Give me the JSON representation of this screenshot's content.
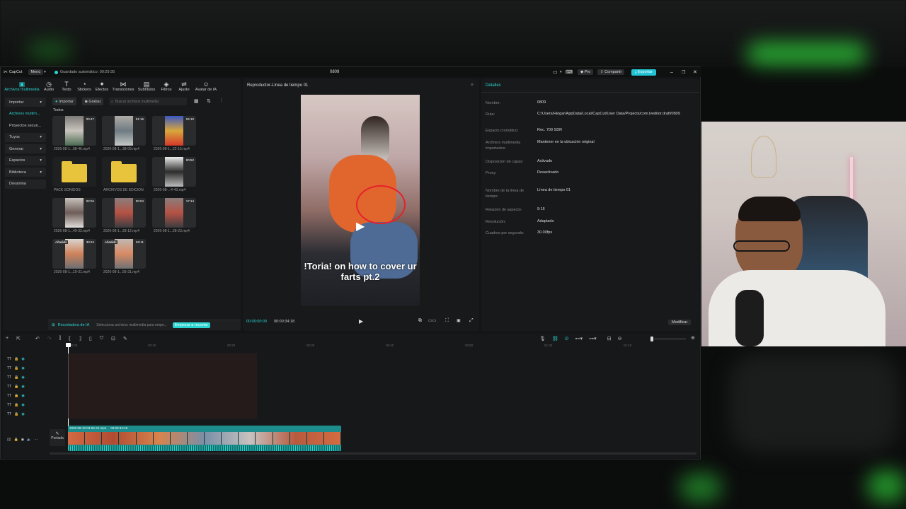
{
  "app": {
    "brand": "CapCut",
    "menu": "Menú",
    "autosave": "Guardado automático: 09:29:35",
    "project_title": "0809",
    "pro_label": "Pro",
    "share_label": "Compartir",
    "export_label": "Exportar"
  },
  "toolbar": {
    "items": [
      {
        "label": "Archivos multimedia",
        "icon": "media-icon"
      },
      {
        "label": "Audio",
        "icon": "audio-icon"
      },
      {
        "label": "Texto",
        "icon": "text-icon"
      },
      {
        "label": "Stickers",
        "icon": "sticker-icon"
      },
      {
        "label": "Efectos",
        "icon": "effects-icon"
      },
      {
        "label": "Transiciones",
        "icon": "transitions-icon"
      },
      {
        "label": "Subtítulos",
        "icon": "subtitles-icon"
      },
      {
        "label": "Filtros",
        "icon": "filters-icon"
      },
      {
        "label": "Ajuste",
        "icon": "adjust-icon"
      },
      {
        "label": "Avatar de IA",
        "icon": "avatar-icon"
      }
    ]
  },
  "sidebar": {
    "items": [
      {
        "label": "Importar"
      },
      {
        "label": "Archivos multim..."
      },
      {
        "label": "Proyectos secun..."
      },
      {
        "label": "Tuyos"
      },
      {
        "label": "Generar"
      },
      {
        "label": "Espacios"
      },
      {
        "label": "Biblioteca"
      },
      {
        "label": "Dreamina"
      }
    ]
  },
  "media": {
    "import_label": "Importar",
    "record_label": "Grabar",
    "search_placeholder": "Buscar archivos multimedia",
    "section_all": "Todos",
    "items": [
      {
        "name": "2026-08-1...08-46.mp4",
        "duration": "00:47",
        "added": ""
      },
      {
        "name": "2026-08-1...38-09.mp4",
        "duration": "01:16",
        "added": ""
      },
      {
        "name": "2026-08-1...22-16.mp4",
        "duration": "04:10",
        "added": ""
      },
      {
        "name": "PACK SONIDOS",
        "duration": "",
        "added": ""
      },
      {
        "name": "ARCHIVOS DE EDICION",
        "duration": "",
        "added": ""
      },
      {
        "name": "2026-08-...4-43.mp4",
        "duration": "00:52",
        "added": ""
      },
      {
        "name": "2026-08-1...49-33.mp4",
        "duration": "02:04",
        "added": ""
      },
      {
        "name": "2026-08-1...28-12.mp4",
        "duration": "00:04",
        "added": ""
      },
      {
        "name": "2026-08-1...28-23.mp4",
        "duration": "17:14",
        "added": ""
      },
      {
        "name": "2026-08-1...19-31.mp4",
        "duration": "33:24",
        "added": "Añadido"
      },
      {
        "name": "2026-08-1...56-31.mp4",
        "duration": "53:11",
        "added": "Añadido"
      }
    ],
    "ai_recorder": "Recortadora de IA",
    "ai_hint": "Selecciona archivos multimedia para empe...",
    "ai_button": "Empezar a recortar"
  },
  "player": {
    "title": "Reproductor-Línea de tiempo 01",
    "caption": "!Toria! on how to cover ur farts pt.2",
    "time_current": "00:00:00:00",
    "time_total": "00:00:34:18"
  },
  "details": {
    "header": "Detalles",
    "rows": [
      {
        "label": "Nombre:",
        "value": "0809"
      },
      {
        "label": "Ruta:",
        "value": "C:/Users/Hiogar/AppData/Local/CapCut/User Data/Projects/com.lveditor.draft/0809"
      },
      {
        "label": "Espacio cromático:",
        "value": "Rec. 709 SDR"
      },
      {
        "label": "Archivos multimedia importados:",
        "value": "Mantener en la ubicación original"
      },
      {
        "label": "Disposición de capas:",
        "value": "Activado"
      },
      {
        "label": "Proxy:",
        "value": "Desactivado"
      },
      {
        "label": "Nombre de la línea de tiempo:",
        "value": "Línea de tiempo 01"
      },
      {
        "label": "Relación de aspecto:",
        "value": "9:16"
      },
      {
        "label": "Resolución:",
        "value": "Adaptado"
      },
      {
        "label": "Cuadros por segundo:",
        "value": "30.00fps"
      }
    ],
    "modify_label": "Modificar"
  },
  "timeline": {
    "ruler": [
      "00:00",
      "00:10",
      "00:20",
      "00:30",
      "00:40",
      "00:50",
      "01:00",
      "01:10"
    ],
    "main_clip_name": "2026-08-10 03-56-31.mp4",
    "main_clip_duration": "00:00:34:18",
    "cover_label": "Portada"
  },
  "colors": {
    "accent": "#2ad5d0",
    "export": "#22c3d4",
    "clip": "#1d8c8c",
    "folder": "#e8c43d"
  }
}
